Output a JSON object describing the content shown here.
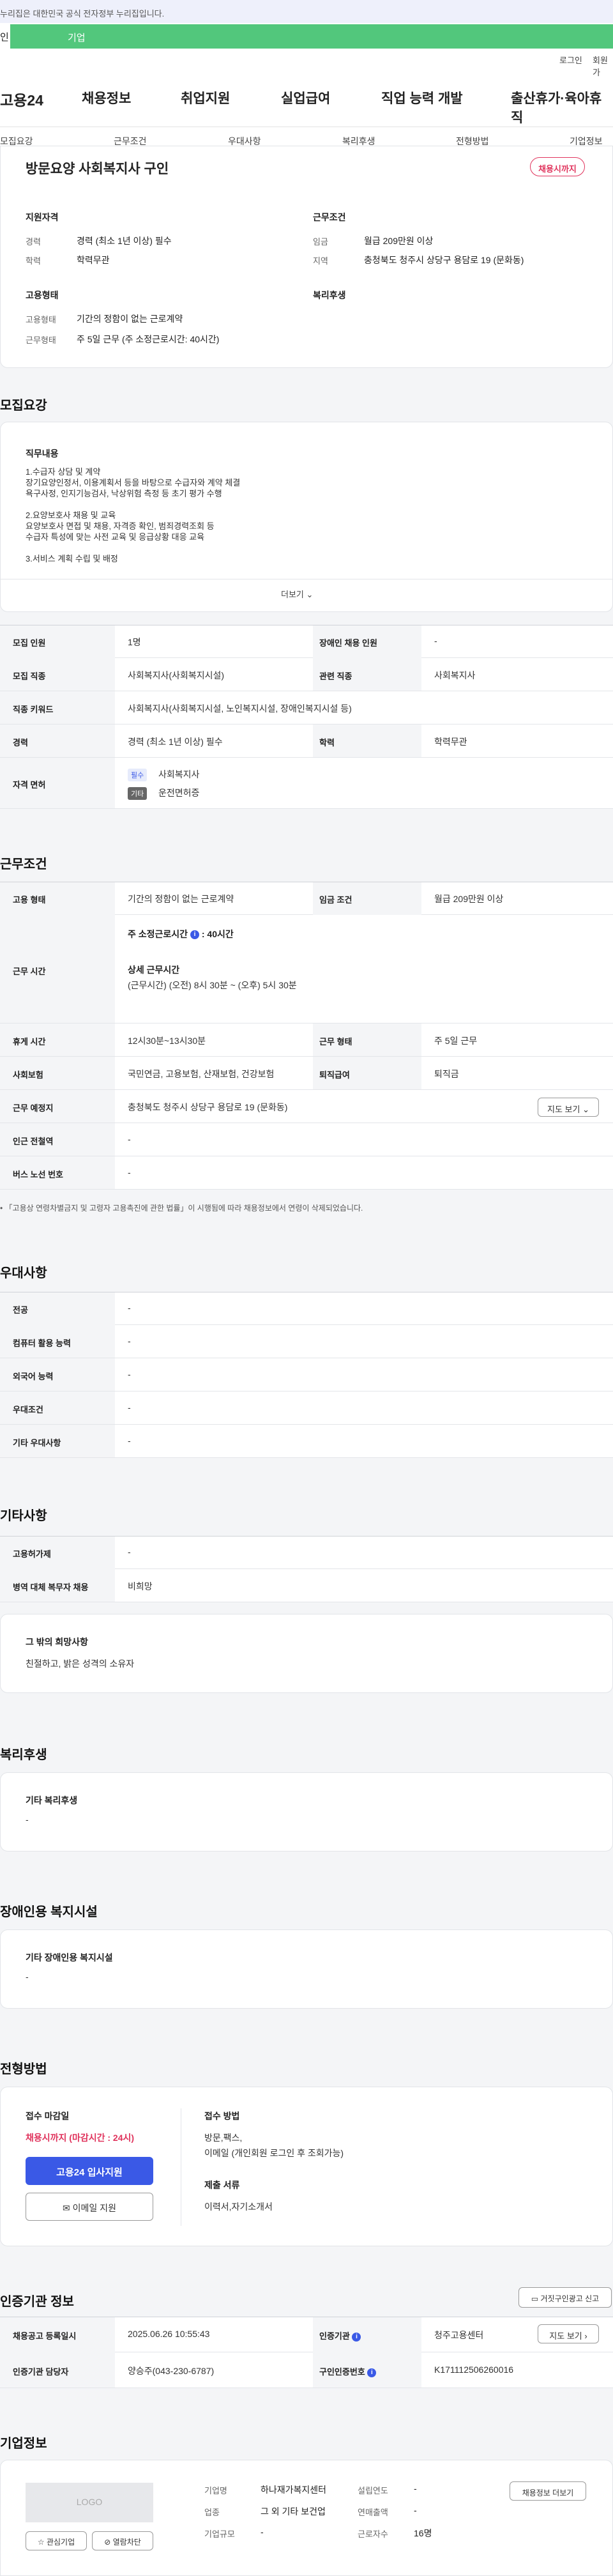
{
  "top": {
    "notice": "누리집은 대한민국 공식 전자정부 누리집입니다.",
    "tab_personal": "인",
    "tab_company": "기업"
  },
  "header": {
    "login": "로그인",
    "signup": "회원가",
    "logo": "고용24",
    "menu": [
      "채용정보",
      "취업지원",
      "실업급여",
      "직업 능력 개발",
      "출산휴가·육아휴직"
    ]
  },
  "subnav": [
    "모집요강",
    "근무조건",
    "우대사항",
    "복리후생",
    "전형방법",
    "기업정보"
  ],
  "summary": {
    "title": "방문요양 사회복지사 구인",
    "status_badge": "채용시까지",
    "qual_title": "지원자격",
    "cond_title": "근무조건",
    "career_label": "경력",
    "career_value": "경력 (최소 1년 이상) 필수",
    "edu_label": "학력",
    "edu_value": "학력무관",
    "wage_label": "임금",
    "wage_value": "월급 209만원 이상",
    "region_label": "지역",
    "region_value": "충청북도 청주시 상당구 용담로 19 (문화동)",
    "employ_title": "고용형태",
    "welfare_title": "복리후생",
    "emptype_label": "고용형태",
    "emptype_value": "기간의 정함이 없는 근로계약",
    "worktype_label": "근무형태",
    "worktype_value": "주 5일 근무 (주 소정근로시간: 40시간)"
  },
  "recruit": {
    "title": "모집요강",
    "duty_title": "직무내용",
    "duty_lines": [
      "1.수급자 상담 및 계약",
      "장기요양인정서, 이용계획서 등을 바탕으로 수급자와 계약 체결",
      "욕구사정, 인지기능검사, 낙상위험 측정 등 초기 평가 수행",
      "",
      "2.요양보호사 채용 및 교육",
      "요양보호사 면접 및 채용, 자격증 확인, 범죄경력조회 등",
      "수급자 특성에 맞는 사전 교육 및 응급상황 대응 교육",
      "",
      "3.서비스 계획 수립 및 배정"
    ],
    "more": "더보기",
    "rows": {
      "headcount_label": "모집 인원",
      "headcount": "1명",
      "disabled_label": "장애인 채용 인원",
      "disabled": "-",
      "job_label": "모집 직종",
      "job": "사회복지사(사회복지시설)",
      "related_label": "관련 직종",
      "related": "사회복지사",
      "keyword_label": "직종 키워드",
      "keyword": "사회복지사(사회복지시설, 노인복지시설, 장애인복지시설 등)",
      "career_label": "경력",
      "career": "경력 (최소 1년 이상) 필수",
      "edu_label": "학력",
      "edu": "학력무관",
      "license_label": "자격 면허",
      "lic_tag1": "필수",
      "lic1": "사회복지사",
      "lic_tag2": "기타",
      "lic2": "운전면허증"
    }
  },
  "work": {
    "title": "근무조건",
    "emptype_label": "고용 형태",
    "emptype": "기간의 정함이 없는 근로계약",
    "wage_label": "임금 조건",
    "wage": "월급 209만원 이상",
    "hours_label": "근무 시간",
    "weekly": "주 소정근로시간",
    "weekly_val": "40시간",
    "detail_title": "상세 근무시간",
    "detail": "(근무시간) (오전) 8시 30분 ~ (오후) 5시 30분",
    "break_label": "휴게 시간",
    "break": "12시30분~13시30분",
    "shift_label": "근무 형태",
    "shift": "주 5일 근무",
    "ins_label": "사회보험",
    "ins": "국민연금, 고용보험, 산재보험, 건강보험",
    "sev_label": "퇴직급여",
    "sev": "퇴직금",
    "place_label": "근무 예정지",
    "place": "충청북도 청주시 상당구 용담로 19 (문화동)",
    "map_btn": "지도 보기",
    "subway_label": "인근 전철역",
    "subway": "-",
    "bus_label": "버스 노선 번호",
    "bus": "-",
    "note": "「고용상 연령차별금지 및 고령자 고용촉진에 관한 법률」이 시행됨에 따라 채용정보에서 연령이 삭제되었습니다."
  },
  "pref": {
    "title": "우대사항",
    "major_label": "전공",
    "major": "-",
    "pc_label": "컴퓨터 활용 능력",
    "pc": "-",
    "lang_label": "외국어 능력",
    "lang": "-",
    "cond_label": "우대조건",
    "cond": "-",
    "etc_label": "기타 우대사항",
    "etc": "-"
  },
  "other": {
    "title": "기타사항",
    "emp_label": "고용허가제",
    "emp": "-",
    "mil_label": "병역 대체 복무자 채용",
    "mil": "비희망",
    "wish_title": "그 밖의 희망사항",
    "wish": "친절하고, 밝은 성격의 소유자"
  },
  "benefit": {
    "title": "복리후생",
    "sub": "기타 복리후생",
    "val": "-"
  },
  "facility": {
    "title": "장애인용 복지시설",
    "sub": "기타 장애인용 복지시설",
    "val": "-"
  },
  "selection": {
    "title": "전형방법",
    "deadline_title": "접수 마감일",
    "deadline": "채용시까지 (마감시간 : 24시)",
    "apply_btn": "고용24 입사지원",
    "email_btn": "이메일 지원",
    "method_title": "접수 방법",
    "method1": "방문,팩스,",
    "method2": "이메일 (개인회원 로그인 후 조회가능)",
    "docs_title": "제출 서류",
    "docs": "이력서,자기소개서"
  },
  "agency": {
    "title": "인증기관 정보",
    "report_btn": "거짓구인광고 신고",
    "reg_label": "채용공고 등록일시",
    "reg": "2025.06.26 10:55:43",
    "org_label": "인증기관",
    "org": "청주고용센터",
    "map_btn": "지도 보기",
    "mgr_label": "인증기관 담당자",
    "mgr": "양승주(043-230-6787)",
    "no_label": "구인인증번호",
    "no": "K171112506260016"
  },
  "company": {
    "title": "기업정보",
    "logo": "LOGO",
    "fav_btn": "관심기업",
    "block_btn": "열람차단",
    "name_label": "기업명",
    "name": "하나재가복지센터",
    "est_label": "설립연도",
    "est": "-",
    "ind_label": "업종",
    "ind": "그 외 기타 보건업",
    "sales_label": "연매출액",
    "sales": "-",
    "size_label": "기업규모",
    "size": "-",
    "emp_label": "근로자수",
    "emp": "16명",
    "more_btn": "채용정보 더보기"
  }
}
